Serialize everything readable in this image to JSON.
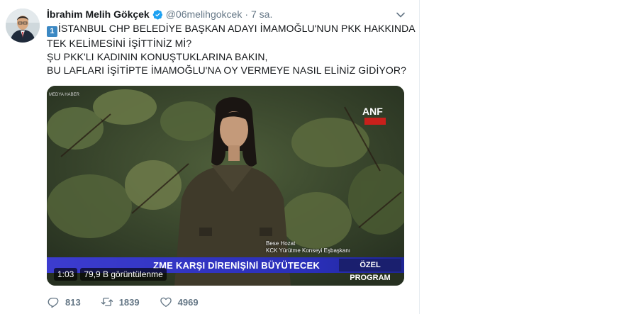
{
  "tweet": {
    "name": "İbrahim Melih Gökçek",
    "handle": "@06melihgokcek",
    "separator": "·",
    "time": "7 sa.",
    "keycap": "1",
    "lines": [
      "İSTANBUL CHP BELEDİYE BAŞKAN ADAYI İMAMOĞLU'NUN PKK HAKKINDA",
      "TEK KELİMESİNİ İŞİTTİNİZ Mİ?",
      "ŞU PKK'LI KADININ KONUŞTUKLARINA BAKIN,",
      "BU LAFLARI İŞİTİPTE İMAMOĞLU'NA OY VERMEYE NASIL ELİNİZ GİDİYOR?"
    ]
  },
  "video": {
    "ticker": "ZME KARŞI DİRENİŞİNİ BÜYÜTECEK",
    "program_label": "ÖZEL PROGRAM",
    "caption_name": "Bese Hozat",
    "caption_title": "KCK Yürütme Konseyi Eşbaşkanı",
    "channel_logo": "ANF",
    "corner_logo": "MEDYA HABER",
    "duration": "1:03",
    "views": "79,9 B görüntülenme"
  },
  "actions": {
    "replies": "813",
    "retweets": "1839",
    "likes": "4969"
  },
  "colors": {
    "accent": "#1da1f2",
    "muted": "#657786",
    "lower_third": "#3c3ccf"
  },
  "icons": [
    "verified-badge-icon",
    "chevron-down-icon",
    "play-badge",
    "reply-icon",
    "retweet-icon",
    "like-icon"
  ]
}
